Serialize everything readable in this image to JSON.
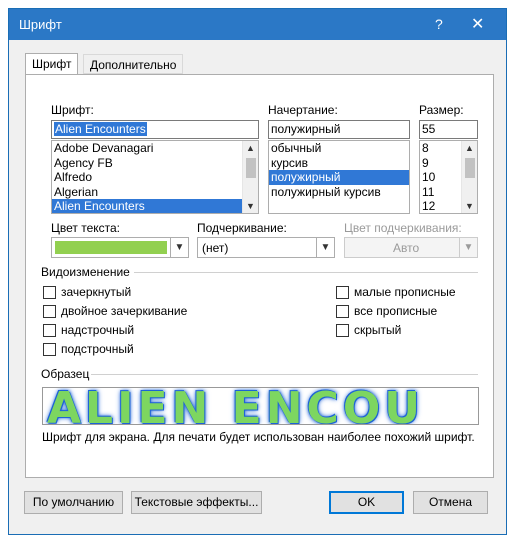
{
  "window": {
    "title": "Шрифт",
    "help": "?",
    "close": "✕"
  },
  "tabs": [
    {
      "label": "Шрифт"
    },
    {
      "label": "Дополнительно"
    }
  ],
  "font": {
    "label": "Шрифт:",
    "value": "Alien Encounters",
    "items": [
      "Adobe Devanagari",
      "Agency FB",
      "Alfredo",
      "Algerian",
      "Alien Encounters"
    ]
  },
  "style": {
    "label": "Начертание:",
    "value": "полужирный",
    "items": [
      "обычный",
      "курсив",
      "полужирный",
      "полужирный курсив"
    ]
  },
  "size": {
    "label": "Размер:",
    "value": "55",
    "items": [
      "8",
      "9",
      "10",
      "11",
      "12"
    ]
  },
  "text_color": {
    "label": "Цвет текста:",
    "swatch": "#92d050"
  },
  "underline": {
    "label": "Подчеркивание:",
    "value": "(нет)"
  },
  "underline_color": {
    "label": "Цвет подчеркивания:",
    "value": "Авто"
  },
  "effects": {
    "label": "Видоизменение",
    "left": [
      "зачеркнутый",
      "двойное зачеркивание",
      "надстрочный",
      "подстрочный"
    ],
    "right": [
      "малые прописные",
      "все прописные",
      "скрытый"
    ]
  },
  "preview": {
    "label": "Образец",
    "sample": "ALIEN ENCOU",
    "note": "Шрифт для экрана. Для печати будет использован наиболее похожий шрифт."
  },
  "buttons": {
    "default": "По умолчанию",
    "text_effects": "Текстовые эффекты...",
    "ok": "OK",
    "cancel": "Отмена"
  }
}
